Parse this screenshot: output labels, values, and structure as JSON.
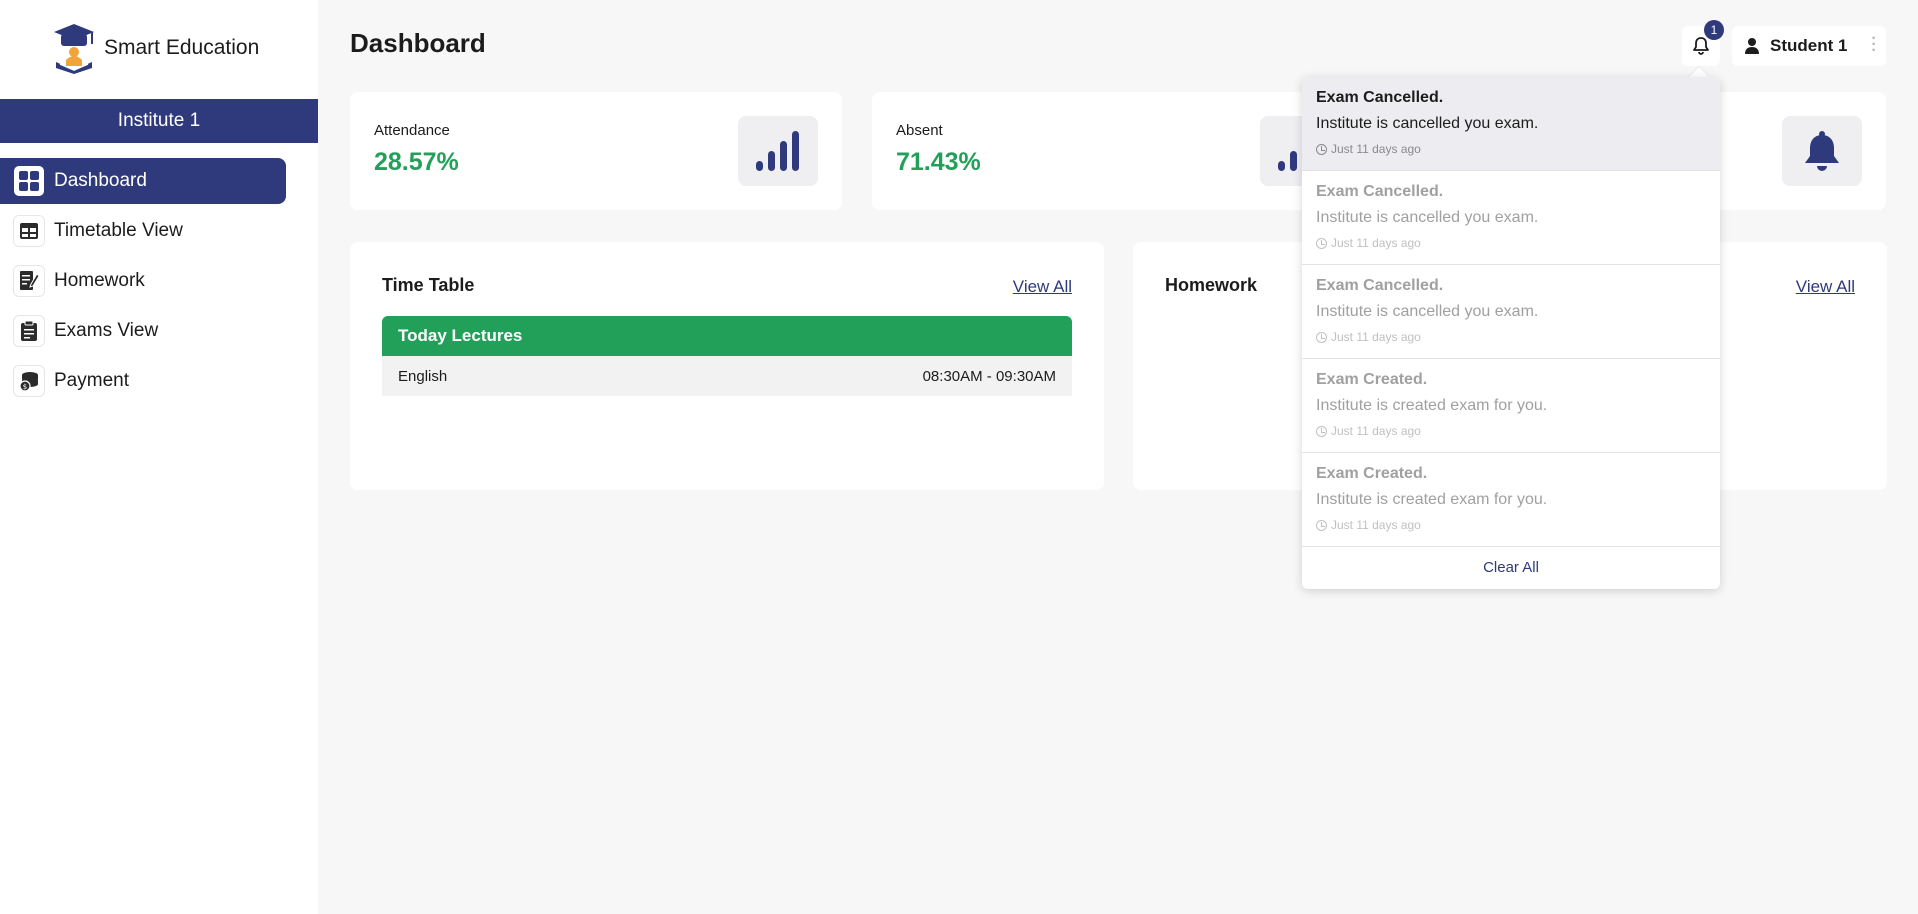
{
  "brand": {
    "name": "Smart Education",
    "logo_icon": "graduation-cap-logo"
  },
  "sidebar": {
    "institute": "Institute 1",
    "items": [
      {
        "label": "Dashboard",
        "icon": "grid-icon",
        "active": true
      },
      {
        "label": "Timetable View",
        "icon": "table-icon",
        "active": false
      },
      {
        "label": "Homework",
        "icon": "notebook-pen-icon",
        "active": false
      },
      {
        "label": "Exams View",
        "icon": "clipboard-icon",
        "active": false
      },
      {
        "label": "Payment",
        "icon": "coins-icon",
        "active": false
      }
    ]
  },
  "header": {
    "title": "Dashboard",
    "notification_count": "1",
    "user_name": "Student 1"
  },
  "stats": [
    {
      "label": "Attendance",
      "value": "28.57%",
      "icon": "signal-bars-icon"
    },
    {
      "label": "Absent",
      "value": "71.43%",
      "icon": "signal-bars-icon"
    },
    {
      "icon": "bell-icon"
    }
  ],
  "timetable": {
    "title": "Time Table",
    "view_all": "View All",
    "today_header": "Today Lectures",
    "lectures": [
      {
        "subject": "English",
        "time": "08:30AM - 09:30AM"
      }
    ]
  },
  "homework": {
    "title": "Homework",
    "view_all": "View All"
  },
  "notifications": {
    "items": [
      {
        "title": "Exam Cancelled.",
        "message": "Institute is cancelled you exam.",
        "time": "Just 11 days ago",
        "unread": true
      },
      {
        "title": "Exam Cancelled.",
        "message": "Institute is cancelled you exam.",
        "time": "Just 11 days ago",
        "unread": false
      },
      {
        "title": "Exam Cancelled.",
        "message": "Institute is cancelled you exam.",
        "time": "Just 11 days ago",
        "unread": false
      },
      {
        "title": "Exam Created.",
        "message": "Institute is created exam for you.",
        "time": "Just 11 days ago",
        "unread": false
      },
      {
        "title": "Exam Created.",
        "message": "Institute is created exam for you.",
        "time": "Just 11 days ago",
        "unread": false
      }
    ],
    "clear_all": "Clear All"
  },
  "colors": {
    "primary": "#2e3a7c",
    "success": "#22a05a",
    "background": "#f7f7f7"
  }
}
